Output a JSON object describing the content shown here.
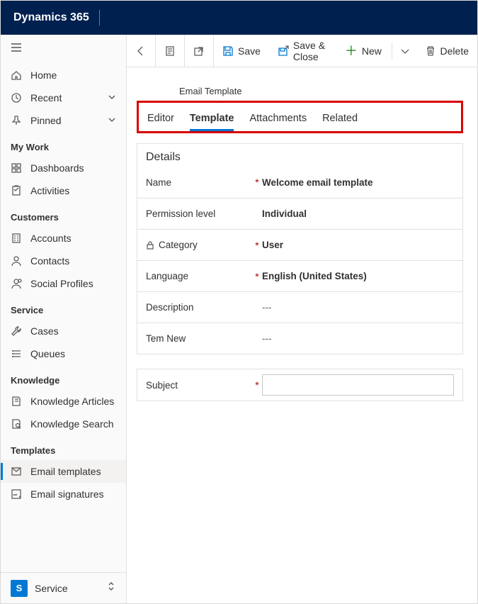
{
  "app_title": "Dynamics 365",
  "sidebar": {
    "top": [
      {
        "label": "Home",
        "icon": "home"
      },
      {
        "label": "Recent",
        "icon": "clock",
        "expand": true
      },
      {
        "label": "Pinned",
        "icon": "pin",
        "expand": true
      }
    ],
    "groups": [
      {
        "header": "My Work",
        "items": [
          {
            "label": "Dashboards",
            "icon": "dashboard"
          },
          {
            "label": "Activities",
            "icon": "clipboard"
          }
        ]
      },
      {
        "header": "Customers",
        "items": [
          {
            "label": "Accounts",
            "icon": "building"
          },
          {
            "label": "Contacts",
            "icon": "person"
          },
          {
            "label": "Social Profiles",
            "icon": "social"
          }
        ]
      },
      {
        "header": "Service",
        "items": [
          {
            "label": "Cases",
            "icon": "wrench"
          },
          {
            "label": "Queues",
            "icon": "queue"
          }
        ]
      },
      {
        "header": "Knowledge",
        "items": [
          {
            "label": "Knowledge Articles",
            "icon": "book"
          },
          {
            "label": "Knowledge Search",
            "icon": "booksearch"
          }
        ]
      },
      {
        "header": "Templates",
        "items": [
          {
            "label": "Email templates",
            "icon": "emailtpl",
            "selected": true
          },
          {
            "label": "Email signatures",
            "icon": "signature"
          }
        ]
      }
    ],
    "area": {
      "badge": "S",
      "label": "Service"
    }
  },
  "commands": {
    "save": "Save",
    "saveclose": "Save & Close",
    "new": "New",
    "delete": "Delete"
  },
  "record_type": "Email Template",
  "tabs": [
    "Editor",
    "Template",
    "Attachments",
    "Related"
  ],
  "active_tab": 1,
  "details": {
    "heading": "Details",
    "fields": [
      {
        "label": "Name",
        "required": true,
        "value": "Welcome email template",
        "strong": true
      },
      {
        "label": "Permission level",
        "required": false,
        "value": "Individual",
        "strong": true
      },
      {
        "label": "Category",
        "required": true,
        "value": "User",
        "strong": true,
        "locked": true
      },
      {
        "label": "Language",
        "required": true,
        "value": "English (United States)",
        "strong": true
      },
      {
        "label": "Description",
        "required": false,
        "value": "---",
        "strong": false
      },
      {
        "label": "Tem New",
        "required": false,
        "value": "---",
        "strong": false
      }
    ]
  },
  "subject": {
    "label": "Subject",
    "required": true,
    "value": ""
  }
}
